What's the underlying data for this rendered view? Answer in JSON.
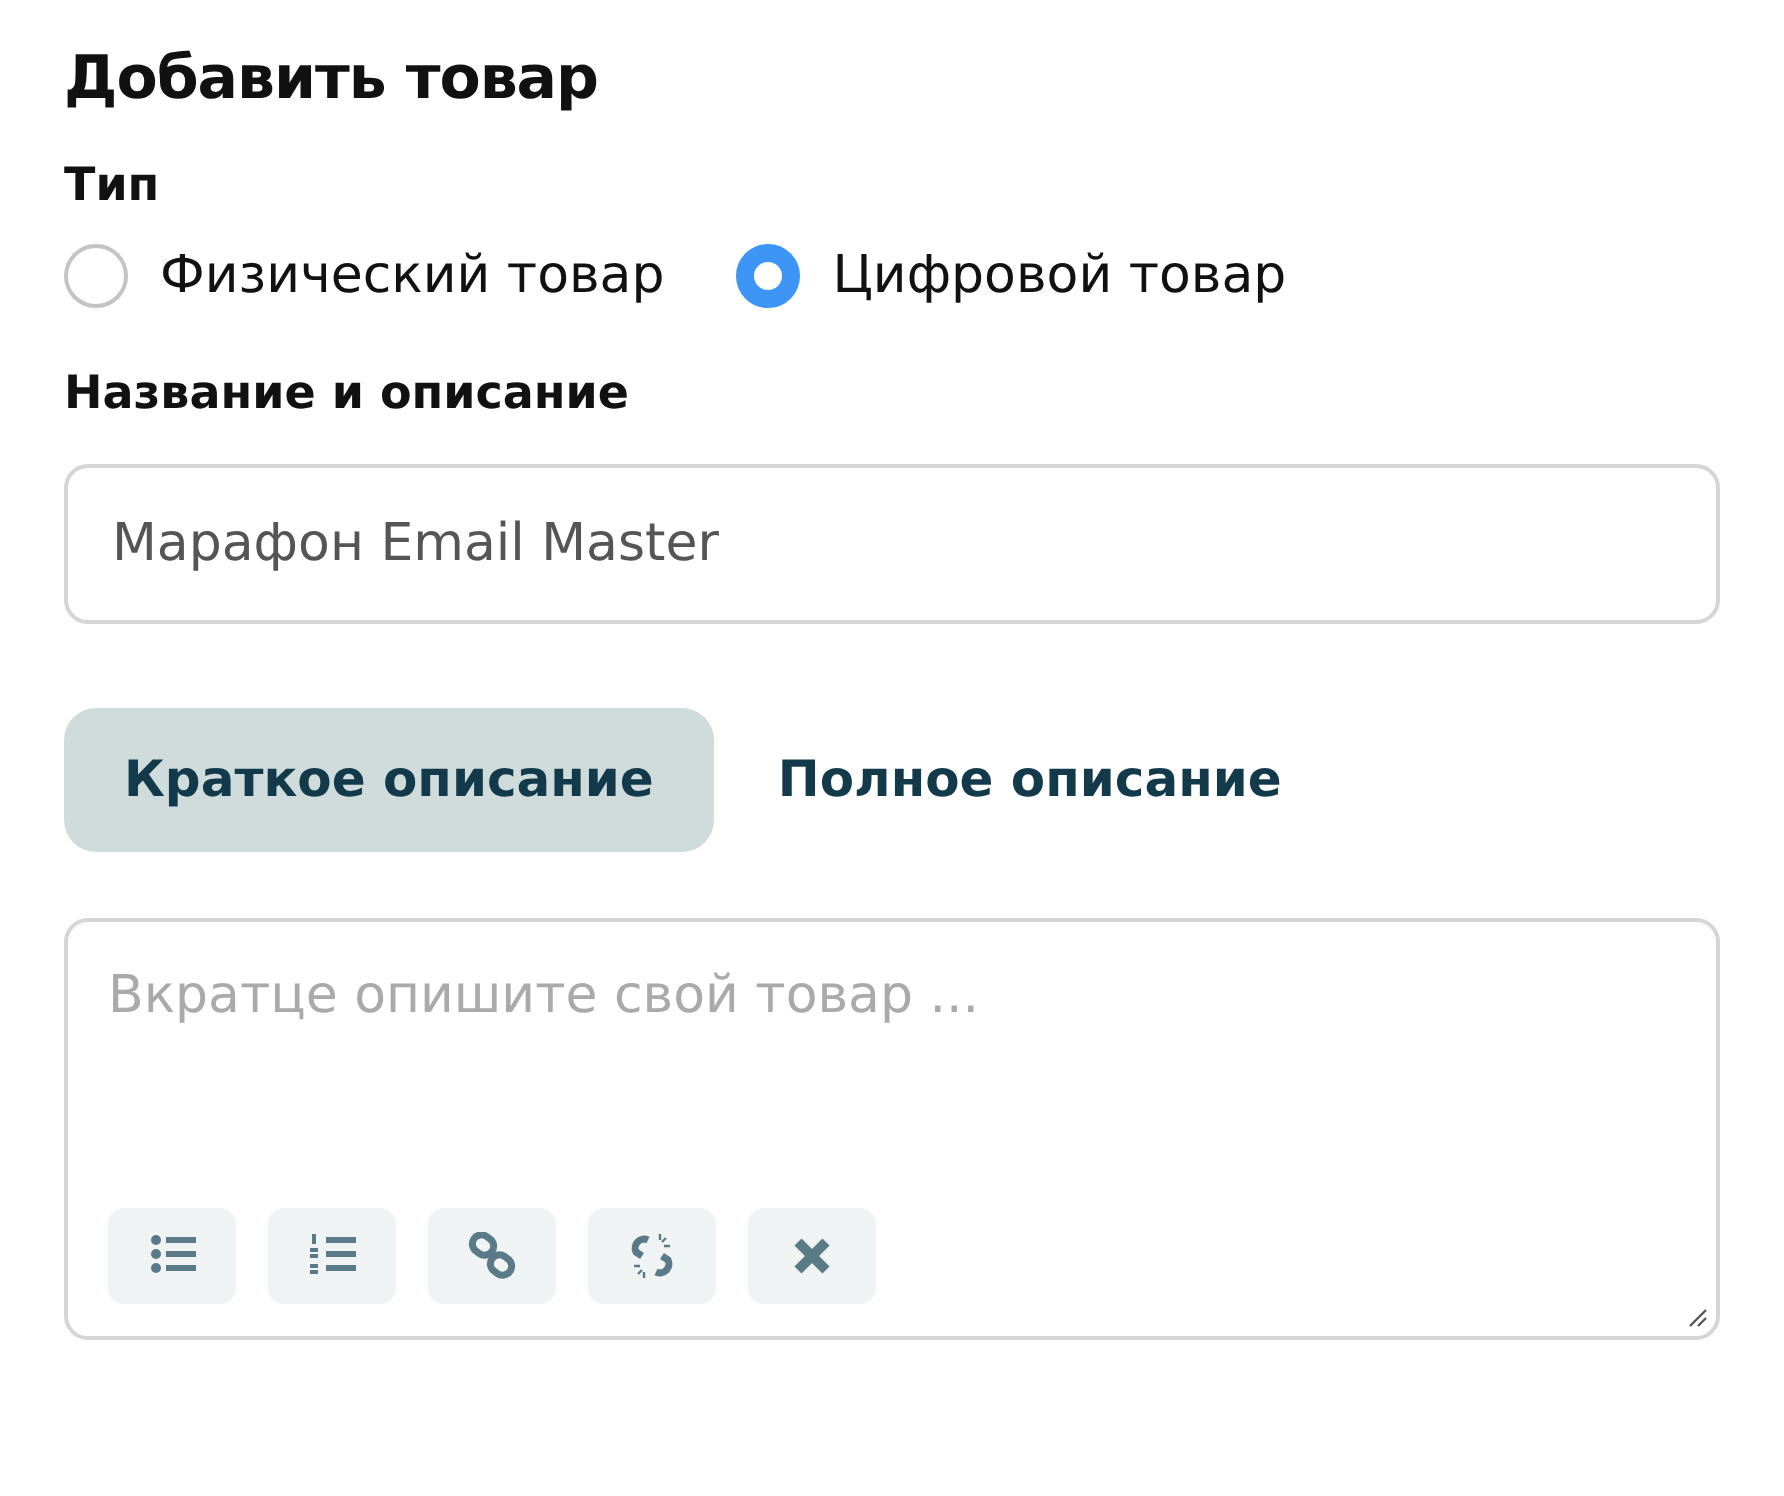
{
  "title": "Добавить товар",
  "type_label": "Тип",
  "types": [
    {
      "label": "Физический товар",
      "selected": false
    },
    {
      "label": "Цифровой товар",
      "selected": true
    }
  ],
  "name_label": "Название и описание",
  "name_field": {
    "value": "Марафон Email Master"
  },
  "tabs": [
    {
      "label": "Краткое описание",
      "selected": true
    },
    {
      "label": "Полное описание",
      "selected": false
    }
  ],
  "description": {
    "placeholder": "Вкратце опишите свой товар ..."
  },
  "toolbar": [
    {
      "kind": "bullets"
    },
    {
      "kind": "numbers"
    },
    {
      "kind": "link"
    },
    {
      "kind": "unlink"
    },
    {
      "kind": "clear"
    }
  ]
}
